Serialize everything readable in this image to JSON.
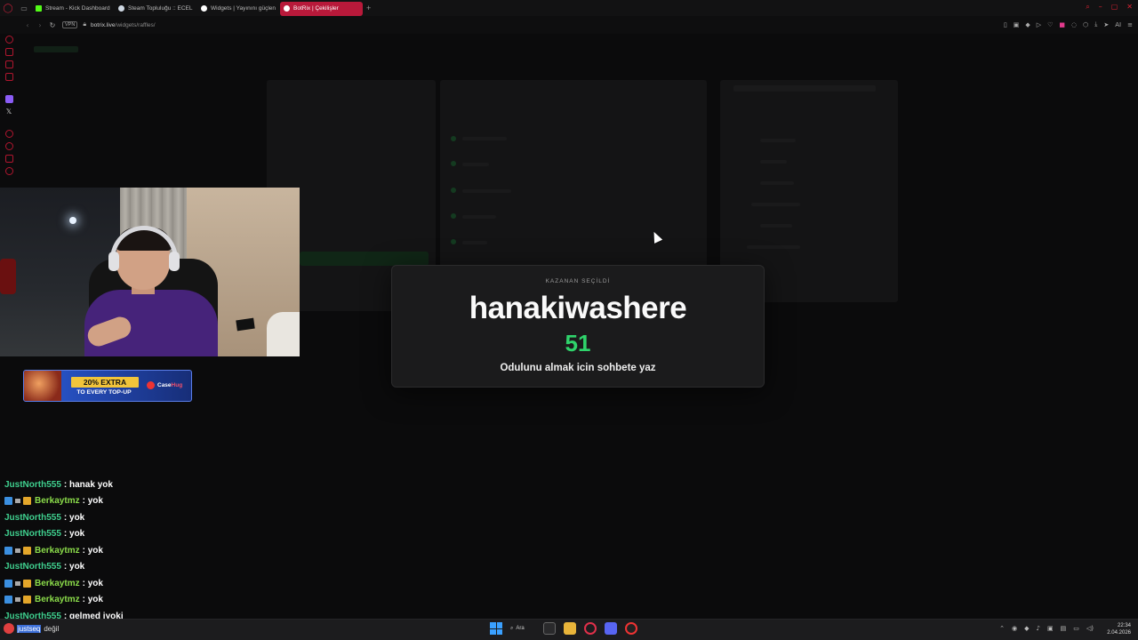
{
  "browser": {
    "tabs": [
      {
        "label": "Stream - Kick Dashboard",
        "color": "#53fc18",
        "active": false
      },
      {
        "label": "Steam Topluluğu :: ECEL",
        "color": "#cfd8e3",
        "active": false
      },
      {
        "label": "Widgets | Yayınını güçlen",
        "color": "#ffffff",
        "active": false
      },
      {
        "label": "BotRix | Çekilişler",
        "color": "#ffffff",
        "active": true
      }
    ],
    "vpn_label": "VPN",
    "url_host": "botrix.live",
    "url_path": "/widgets/raffles/",
    "ext_ai_label": "AI"
  },
  "winner": {
    "heading": "KAZANAN SEÇİLDİ",
    "name": "hanakiwashere",
    "number": "51",
    "message": "Odulunu almak icin sohbete yaz"
  },
  "sponsor": {
    "extra": "20% EXTRA",
    "sub": "TO EVERY TOP-UP",
    "brand_a": "Case",
    "brand_b": "Hug"
  },
  "chat": [
    {
      "user": "JustNorth555",
      "text": ": hanak yok",
      "badges": false
    },
    {
      "user": "Berkaytmz",
      "text": ": yok",
      "badges": true
    },
    {
      "user": "JustNorth555",
      "text": ": yok",
      "badges": false
    },
    {
      "user": "JustNorth555",
      "text": ": yok",
      "badges": false
    },
    {
      "user": "Berkaytmz",
      "text": ": yok",
      "badges": true
    },
    {
      "user": "JustNorth555",
      "text": ": yok",
      "badges": false
    },
    {
      "user": "Berkaytmz",
      "text": ": yok",
      "badges": true
    },
    {
      "user": "Berkaytmz",
      "text": ": yok",
      "badges": true
    },
    {
      "user": "JustNorth555",
      "text": ": gelmed iyoki",
      "badges": false
    }
  ],
  "taskbar": {
    "weather_a": "justseq",
    "weather_b": "değil",
    "search_label": "Ara",
    "time": "22:34",
    "date": "2.04.2026"
  },
  "colors": {
    "accent": "#b8193a",
    "winner_number": "#2fd36b",
    "chat_user": "#3fcf8e"
  }
}
